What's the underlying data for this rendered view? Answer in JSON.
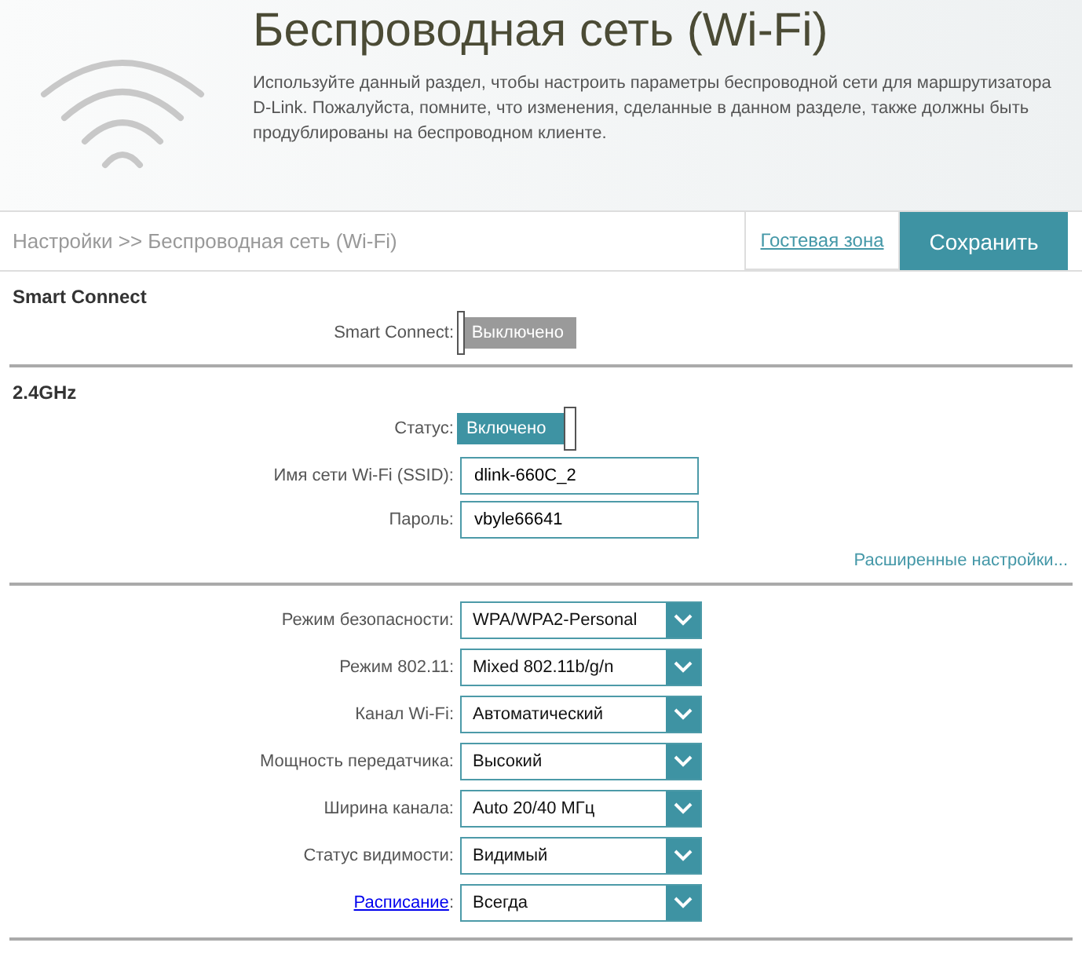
{
  "header": {
    "title": "Беспроводная сеть (Wi-Fi)",
    "description": "Используйте данный раздел, чтобы настроить параметры беспроводной сети для маршрутизатора D-Link. Пожалуйста, помните, что изменения, сделанные в данном разделе, также должны быть продублированы на беспроводном клиенте."
  },
  "toolbar": {
    "breadcrumb": "Настройки >> Беспроводная сеть (Wi-Fi)",
    "guest_link": "Гостевая зона",
    "save_button": "Сохранить"
  },
  "smart_connect": {
    "heading": "Smart Connect",
    "toggle": {
      "label": "Smart Connect:",
      "on": false,
      "text": "Выключено"
    }
  },
  "band": {
    "heading": "2.4GHz",
    "status": {
      "label": "Статус:",
      "on": true,
      "text": "Включено"
    },
    "fields": [
      {
        "label": "Имя сети Wi-Fi (SSID):",
        "value": "dlink-660C_2"
      },
      {
        "label": "Пароль:",
        "value": "vbyle66641"
      }
    ],
    "advanced_link": "Расширенные настройки..."
  },
  "selects": [
    {
      "kind": "plain",
      "label": "Режим безопасности:",
      "value": "WPA/WPA2-Personal"
    },
    {
      "kind": "plain",
      "label": "Режим 802.11:",
      "value": "Mixed 802.11b/g/n"
    },
    {
      "kind": "plain",
      "label": "Канал Wi-Fi:",
      "value": "Автоматический"
    },
    {
      "kind": "plain",
      "label": "Мощность передатчика:",
      "value": "Высокий"
    },
    {
      "kind": "plain",
      "label": "Ширина канала:",
      "value": "Auto 20/40 МГц"
    },
    {
      "kind": "plain",
      "label": "Статус видимости:",
      "value": "Видимый"
    },
    {
      "kind": "link",
      "label": "Расписание",
      "suffix": ":",
      "value": "Всегда"
    }
  ]
}
